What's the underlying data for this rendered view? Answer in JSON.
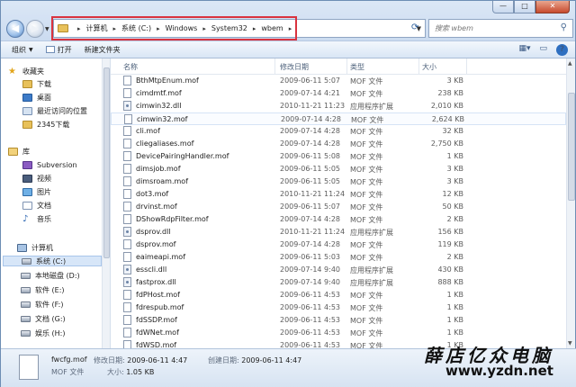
{
  "window": {
    "caption": {
      "minimize": "—",
      "maximize": "□",
      "close": "✕"
    }
  },
  "address": {
    "crumbs": [
      "计算机",
      "系统 (C:)",
      "Windows",
      "System32",
      "wbem"
    ],
    "search_placeholder": "搜索 wbem"
  },
  "toolbar": {
    "organize": "组织",
    "open": "打开",
    "new_folder": "新建文件夹"
  },
  "nav": {
    "favorites": "收藏夹",
    "downloads": "下载",
    "desktop": "桌面",
    "recent": "最近访问的位置",
    "downloads2345": "2345下载",
    "libraries": "库",
    "subversion": "Subversion",
    "videos": "视频",
    "pictures": "图片",
    "documents": "文档",
    "music": "音乐",
    "computer": "计算机",
    "drives": [
      "系统 (C:)",
      "本地磁盘 (D:)",
      "软件 (E:)",
      "软件 (F:)",
      "文档 (G:)",
      "娱乐 (H:)"
    ]
  },
  "columns": {
    "name": "名称",
    "date": "修改日期",
    "type": "类型",
    "size": "大小"
  },
  "files": [
    {
      "name": "BthMtpEnum.mof",
      "date": "2009-06-11 5:07",
      "type": "MOF 文件",
      "size": "3 KB",
      "kind": "mof"
    },
    {
      "name": "cimdmtf.mof",
      "date": "2009-07-14 4:21",
      "type": "MOF 文件",
      "size": "238 KB",
      "kind": "mof"
    },
    {
      "name": "cimwin32.dll",
      "date": "2010-11-21 11:23",
      "type": "应用程序扩展",
      "size": "2,010 KB",
      "kind": "dll"
    },
    {
      "name": "cimwin32.mof",
      "date": "2009-07-14 4:28",
      "type": "MOF 文件",
      "size": "2,624 KB",
      "kind": "mof"
    },
    {
      "name": "cli.mof",
      "date": "2009-07-14 4:28",
      "type": "MOF 文件",
      "size": "32 KB",
      "kind": "mof"
    },
    {
      "name": "cliegaliases.mof",
      "date": "2009-07-14 4:28",
      "type": "MOF 文件",
      "size": "2,750 KB",
      "kind": "mof"
    },
    {
      "name": "DevicePairingHandler.mof",
      "date": "2009-06-11 5:08",
      "type": "MOF 文件",
      "size": "1 KB",
      "kind": "mof"
    },
    {
      "name": "dimsjob.mof",
      "date": "2009-06-11 5:05",
      "type": "MOF 文件",
      "size": "3 KB",
      "kind": "mof"
    },
    {
      "name": "dimsroam.mof",
      "date": "2009-06-11 5:05",
      "type": "MOF 文件",
      "size": "3 KB",
      "kind": "mof"
    },
    {
      "name": "dot3.mof",
      "date": "2010-11-21 11:24",
      "type": "MOF 文件",
      "size": "12 KB",
      "kind": "mof"
    },
    {
      "name": "drvinst.mof",
      "date": "2009-06-11 5:07",
      "type": "MOF 文件",
      "size": "50 KB",
      "kind": "mof"
    },
    {
      "name": "DShowRdpFilter.mof",
      "date": "2009-07-14 4:28",
      "type": "MOF 文件",
      "size": "2 KB",
      "kind": "mof"
    },
    {
      "name": "dsprov.dll",
      "date": "2010-11-21 11:24",
      "type": "应用程序扩展",
      "size": "156 KB",
      "kind": "dll"
    },
    {
      "name": "dsprov.mof",
      "date": "2009-07-14 4:28",
      "type": "MOF 文件",
      "size": "119 KB",
      "kind": "mof"
    },
    {
      "name": "eaimeapi.mof",
      "date": "2009-06-11 5:03",
      "type": "MOF 文件",
      "size": "2 KB",
      "kind": "mof"
    },
    {
      "name": "esscli.dll",
      "date": "2009-07-14 9:40",
      "type": "应用程序扩展",
      "size": "430 KB",
      "kind": "dll"
    },
    {
      "name": "fastprox.dll",
      "date": "2009-07-14 9:40",
      "type": "应用程序扩展",
      "size": "888 KB",
      "kind": "dll"
    },
    {
      "name": "fdPHost.mof",
      "date": "2009-06-11 4:53",
      "type": "MOF 文件",
      "size": "1 KB",
      "kind": "mof"
    },
    {
      "name": "fdrespub.mof",
      "date": "2009-06-11 4:53",
      "type": "MOF 文件",
      "size": "1 KB",
      "kind": "mof"
    },
    {
      "name": "fdSSDP.mof",
      "date": "2009-06-11 4:53",
      "type": "MOF 文件",
      "size": "1 KB",
      "kind": "mof"
    },
    {
      "name": "fdWNet.mof",
      "date": "2009-06-11 4:53",
      "type": "MOF 文件",
      "size": "1 KB",
      "kind": "mof"
    },
    {
      "name": "fdWSD.mof",
      "date": "2009-06-11 4:53",
      "type": "MOF 文件",
      "size": "1 KB",
      "kind": "mof"
    }
  ],
  "details": {
    "name": "fwcfg.mof",
    "modified_label": "修改日期:",
    "modified": "2009-06-11 4:47",
    "created_label": "创建日期:",
    "created": "2009-06-11 4:47",
    "type": "MOF 文件",
    "size_label": "大小:",
    "size": "1.05 KB"
  },
  "watermark": {
    "title": "薛店亿众电脑",
    "url": "www.yzdn.net"
  }
}
